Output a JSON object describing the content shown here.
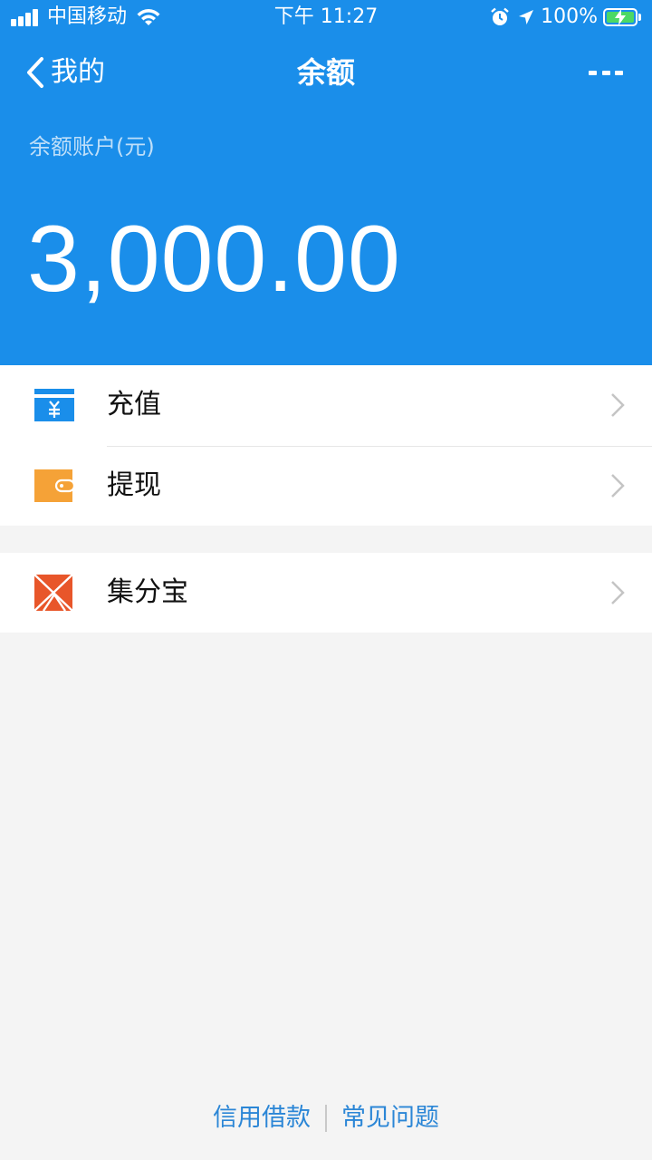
{
  "status_bar": {
    "carrier": "中国移动",
    "time": "下午 11:27",
    "battery_percent": "100%"
  },
  "nav": {
    "back_label": "我的",
    "title": "余额"
  },
  "balance": {
    "label": "余额账户(元)",
    "amount": "3,000.00"
  },
  "menu": [
    {
      "label": "充值",
      "icon": "recharge-yuan-icon"
    },
    {
      "label": "提现",
      "icon": "wallet-icon"
    },
    {
      "label": "集分宝",
      "icon": "jifenbao-icon"
    }
  ],
  "footer": {
    "link_credit": "信用借款",
    "link_faq": "常见问题"
  },
  "colors": {
    "header_blue": "#1a8eea",
    "recharge_icon": "#1a8eea",
    "withdraw_icon": "#f5a237",
    "jifenbao_icon": "#e8562a",
    "link_blue": "#2b86d6"
  }
}
